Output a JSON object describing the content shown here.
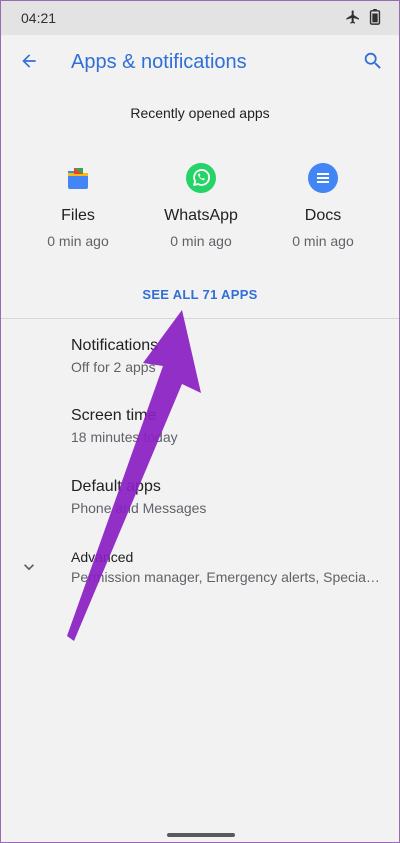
{
  "status_bar": {
    "time": "04:21",
    "icons": [
      "airplane-mode-icon",
      "battery-icon"
    ]
  },
  "app_bar": {
    "title": "Apps & notifications",
    "back_icon": "back-arrow-icon",
    "search_icon": "search-icon"
  },
  "recent": {
    "title": "Recently opened apps",
    "apps": [
      {
        "name": "Files",
        "time": "0 min ago",
        "icon": "files-app-icon"
      },
      {
        "name": "WhatsApp",
        "time": "0 min ago",
        "icon": "whatsapp-app-icon"
      },
      {
        "name": "Docs",
        "time": "0 min ago",
        "icon": "docs-app-icon"
      }
    ],
    "see_all": "SEE ALL 71 APPS"
  },
  "settings": [
    {
      "title": "Notifications",
      "summary": "Off for 2 apps"
    },
    {
      "title": "Screen time",
      "summary": "18 minutes today"
    },
    {
      "title": "Default apps",
      "summary": "Phone and Messages"
    },
    {
      "title": "Advanced",
      "summary": "Permission manager, Emergency alerts, Special app access"
    }
  ],
  "colors": {
    "accent": "#2f6fd6",
    "annotation_arrow": "#8a1ec2",
    "whatsapp": "#25d366",
    "docs": "#4285f4"
  }
}
